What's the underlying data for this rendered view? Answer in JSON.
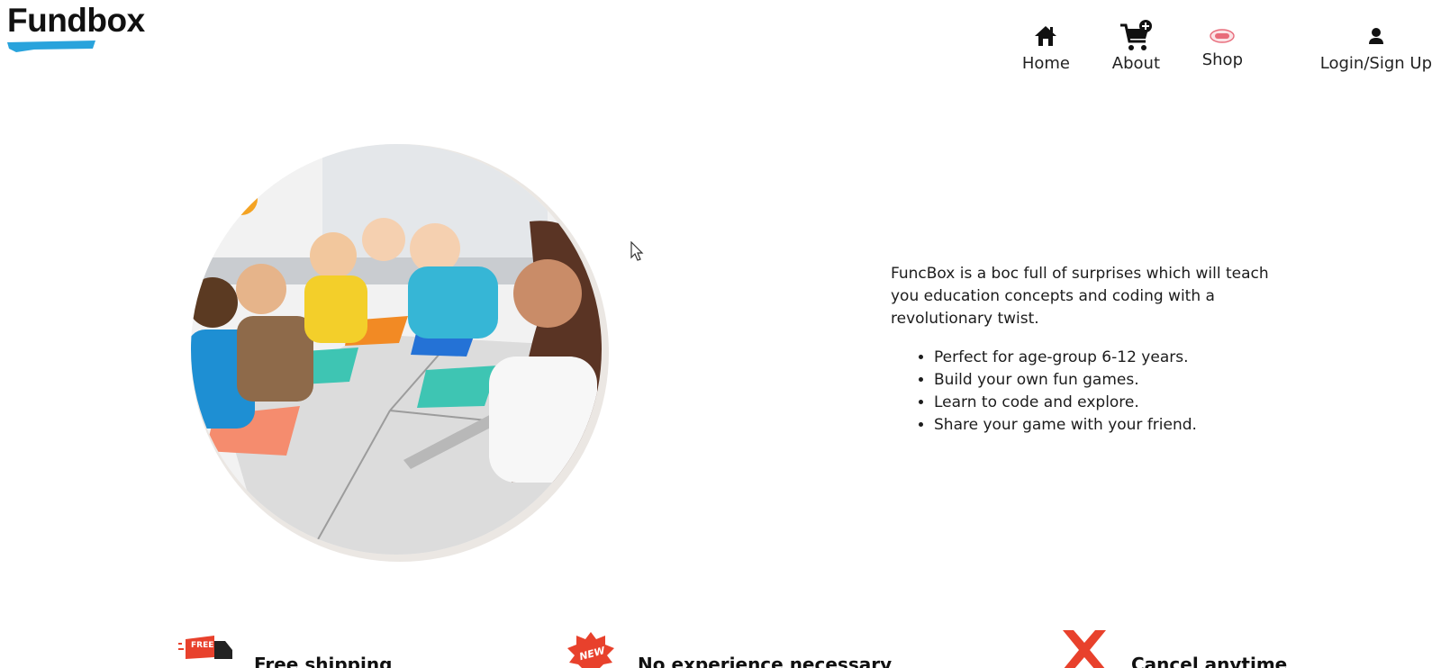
{
  "brand": {
    "name": "Fundbox",
    "stripe_color": "#29a3dc"
  },
  "nav": {
    "items": [
      {
        "label": "Home",
        "icon": "home-icon"
      },
      {
        "label": "About",
        "icon": "cart-icon"
      },
      {
        "label": "Shop",
        "icon": "shop-badge-icon"
      },
      {
        "label": "Login/Sign Up",
        "icon": "user-icon"
      }
    ]
  },
  "hero": {
    "image": "children-classroom-photo",
    "intro": "FuncBox is a boc full of surprises which will teach you education concepts and coding with a revolutionary twist.",
    "features": [
      "Perfect for age-group 6-12 years.",
      "Build your own fun games.",
      "Learn to code and explore.",
      "Share your game with your friend."
    ]
  },
  "benefits": [
    {
      "label": "Free shipping",
      "icon": "free-delivery-truck-icon",
      "badge": "FREE"
    },
    {
      "label": "No experience necessary",
      "icon": "new-badge-icon",
      "badge": "NEW"
    },
    {
      "label": "Cancel anytime",
      "icon": "cancel-x-icon"
    }
  ],
  "colors": {
    "accent_red": "#e8412c",
    "text": "#1c1c1c"
  }
}
